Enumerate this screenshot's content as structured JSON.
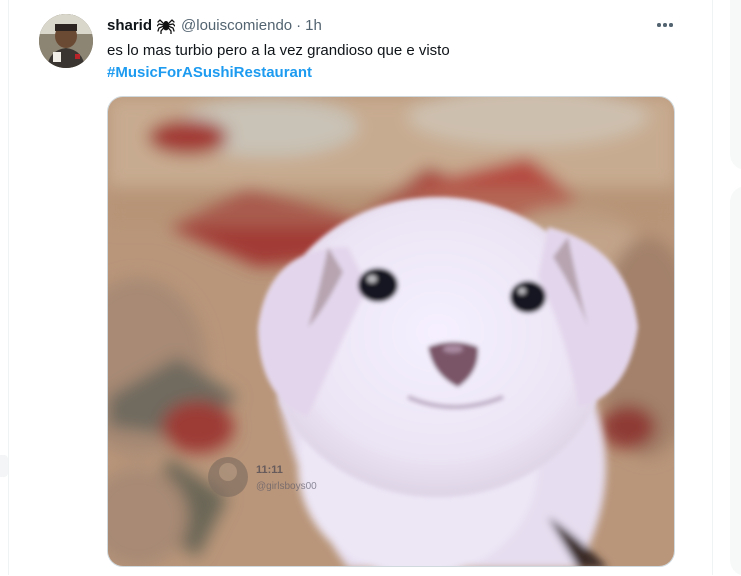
{
  "tweet": {
    "display_name": "sharid",
    "name_emoji": "spider-icon",
    "handle": "@louiscomiendo",
    "separator": "·",
    "time": "1h",
    "text": "es lo mas turbio pero a la vez grandioso que e visto",
    "hashtag": "#MusicForASushiRestaurant",
    "media": {
      "subject": "white puppy",
      "watermark_time": "11:11",
      "watermark_user": "@girlsboys00"
    }
  },
  "colors": {
    "text_primary": "#0f1419",
    "text_secondary": "#536471",
    "link": "#1d9bf0",
    "border": "#cfd9de"
  }
}
